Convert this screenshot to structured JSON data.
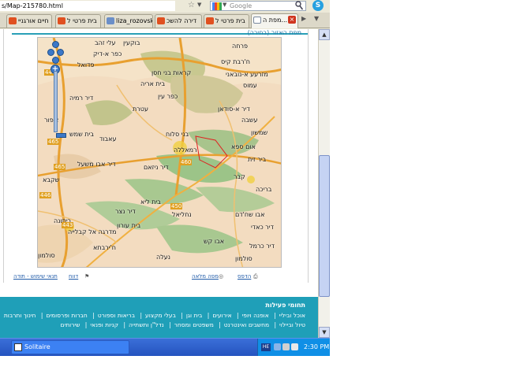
{
  "browser": {
    "url": "s/Map-215780.html",
    "search_placeholder": "Google",
    "skype_label": "S"
  },
  "tabs": [
    {
      "label": "חיים אורגניי"
    },
    {
      "label": "בית פרטי ל"
    },
    {
      "label": "liza_rozovsk..."
    },
    {
      "label": "דירה להשכ"
    },
    {
      "label": "בית פרטי ל"
    },
    {
      "label": "מפת ה..."
    }
  ],
  "page": {
    "header_text": "מפת האזור (בחירה)",
    "map_labels": [
      "עלי זהב",
      "בוקעין",
      "ח'רבת קיס",
      "כפר א-דיק",
      "כפר ביתיה",
      "פדואל",
      "קראות בני חסן",
      "מזרעע א-נובאני",
      "עמוס",
      "פרחה",
      "דיר א-סודאן",
      "ברוכין",
      "בית אריה",
      "עבוד",
      "דיר רמיה",
      "ביר זית",
      "עטרת",
      "ענבוב",
      "בני סלוח",
      "כפר עין",
      "בית ריאן",
      "רנתיס",
      "עמריה",
      "ציפור",
      "בית שמש",
      "א-לבאן",
      "שפרים",
      "נעלין",
      "נבי סאלח",
      "דיר ניזאם",
      "כוכב יעקב",
      "פסגות",
      "אום ספא",
      "בית אל",
      "דיר אבו משעל",
      "בית ליא",
      "עשבה",
      "דיר עמר",
      "קבר",
      "בית עורון",
      "תחתון",
      "נחליאל",
      "בית סירא",
      "שילת",
      "כוכב השחר",
      "רמון",
      "שקבא",
      "דיר נצר",
      "עאבוד",
      "בריכה",
      "אבו שח'דם",
      "דיר כרמל",
      "סולמון",
      "ביתונה",
      "נעלה",
      "ח'ירבתא",
      "מדרגה אל קבלייה",
      "אבו קש",
      "דיר כאדי",
      "שמשון",
      "רמאללה"
    ],
    "roads": [
      "446",
      "465",
      "460",
      "450",
      "465",
      "446",
      "443"
    ],
    "links": {
      "print": "הדפס",
      "full_map": "מפה מלאה",
      "report": "דווח",
      "terms": "תנאי שימוש - תודה"
    }
  },
  "footer": {
    "title": "תחומי פעילות",
    "row1": [
      "אוכל וביליי",
      "אופנה ויופי",
      "אירועים",
      "בית וגן",
      "בעלי מקצוע",
      "בריאות וספורט",
      "חברות ופרסומים",
      "חינוך ותרבות"
    ],
    "row2": [
      "טיול וביילוי",
      "מחשבים ואינטרנט",
      "משפטים ומסחר",
      "נדל\"ן ותשתייה",
      "קניות ופנאי",
      "שירותים"
    ]
  },
  "taskbar": {
    "task_label": "Solitaire",
    "lang": "HE",
    "clock": "2:30 PM"
  },
  "colors": {
    "footer_bg": "#1f9fb8",
    "taskbar_bg": "#2453bf",
    "link": "#1f5aa8"
  }
}
